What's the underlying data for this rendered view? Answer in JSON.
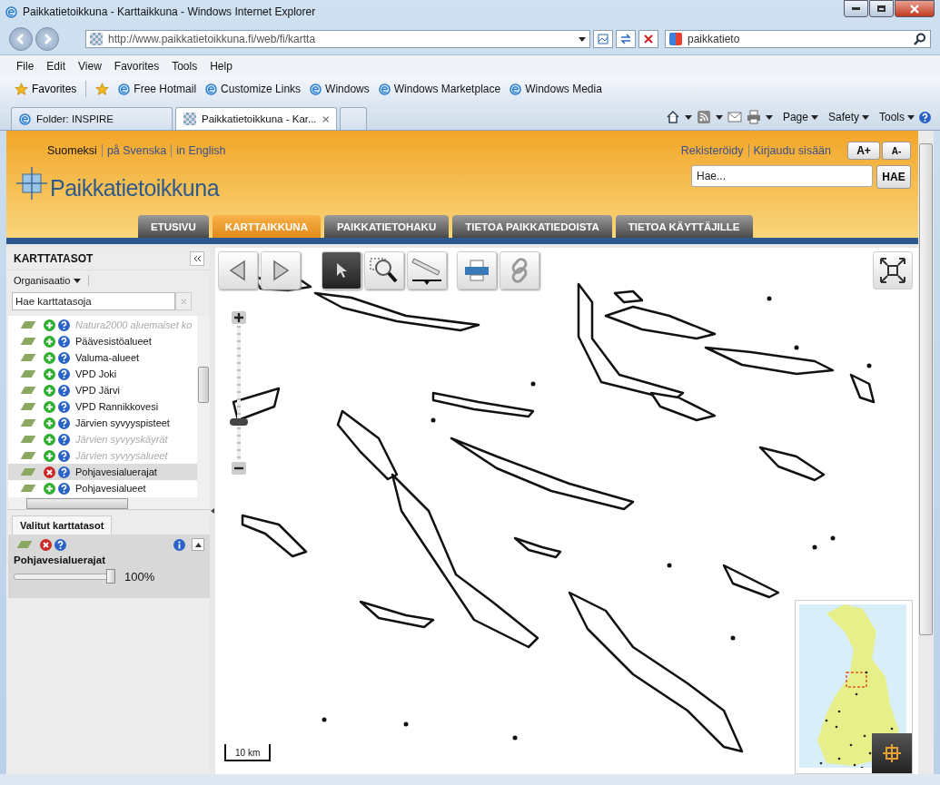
{
  "window": {
    "title": "Paikkatietoikkuna - Karttaikkuna - Windows Internet Explorer"
  },
  "address_bar": {
    "url": "http://www.paikkatietoikkuna.fi/web/fi/kartta"
  },
  "search_box": {
    "value": "paikkatieto"
  },
  "menu": [
    "File",
    "Edit",
    "View",
    "Favorites",
    "Tools",
    "Help"
  ],
  "favorites_bar": {
    "label": "Favorites",
    "links": [
      "Free Hotmail",
      "Customize Links",
      "Windows",
      "Windows Marketplace",
      "Windows Media"
    ]
  },
  "browser_tabs": [
    {
      "label": "Folder: INSPIRE",
      "selected": false
    },
    {
      "label": "Paikkatietoikkuna - Kar...",
      "selected": true
    }
  ],
  "command_bar": [
    "Page",
    "Safety",
    "Tools"
  ],
  "site": {
    "languages": [
      {
        "label": "Suomeksi",
        "selected": true
      },
      {
        "label": "på Svenska",
        "selected": false
      },
      {
        "label": "in English",
        "selected": false
      }
    ],
    "account_links": [
      "Rekisteröidy",
      "Kirjaudu sisään"
    ],
    "font_buttons": [
      "A+",
      "A-"
    ],
    "logo": "Paikkatietoikkuna",
    "search": {
      "placeholder": "Hae...",
      "button": "HAE"
    },
    "nav": [
      {
        "label": "ETUSIVU",
        "selected": false
      },
      {
        "label": "KARTTAIKKUNA",
        "selected": true
      },
      {
        "label": "PAIKKATIETOHAKU",
        "selected": false
      },
      {
        "label": "TIETOA PAIKKATIEDOISTA",
        "selected": false
      },
      {
        "label": "TIETOA KÄYTTÄJILLE",
        "selected": false
      }
    ]
  },
  "layer_panel": {
    "title": "KARTTATASOT",
    "filter": "Organisaatio",
    "search": {
      "placeholder": "Hae karttatasoja"
    },
    "layers": [
      {
        "name": "Natura2000 aluemaiset ko",
        "added": false,
        "disabled": true,
        "selected": false
      },
      {
        "name": "Päävesistöalueet",
        "added": false,
        "disabled": false,
        "selected": false
      },
      {
        "name": "Valuma-alueet",
        "added": false,
        "disabled": false,
        "selected": false
      },
      {
        "name": "VPD Joki",
        "added": false,
        "disabled": false,
        "selected": false
      },
      {
        "name": "VPD Järvi",
        "added": false,
        "disabled": false,
        "selected": false
      },
      {
        "name": "VPD Rannikkovesi",
        "added": false,
        "disabled": false,
        "selected": false
      },
      {
        "name": "Järvien syvyyspisteet",
        "added": false,
        "disabled": false,
        "selected": false
      },
      {
        "name": "Järvien syvyyskäyrät",
        "added": false,
        "disabled": true,
        "selected": false
      },
      {
        "name": "Järvien syvyysalueet",
        "added": false,
        "disabled": true,
        "selected": false
      },
      {
        "name": "Pohjavesialuerajat",
        "added": true,
        "disabled": false,
        "selected": true
      },
      {
        "name": "Pohjavesialueet",
        "added": false,
        "disabled": false,
        "selected": false
      }
    ]
  },
  "selected_layers": {
    "tab": "Valitut karttatasot",
    "layers": [
      {
        "name": "Pohjavesialuerajat",
        "opacity": {
          "level": 1,
          "reading": "100%"
        }
      }
    ]
  },
  "map": {
    "zoom": {
      "level": 0.27
    },
    "tools": [
      {
        "kind": "back",
        "selected": false
      },
      {
        "kind": "forward",
        "selected": false
      },
      {
        "kind": "select",
        "selected": true
      },
      {
        "kind": "zoom-box",
        "selected": false
      },
      {
        "kind": "measure",
        "selected": false
      },
      {
        "kind": "print",
        "selected": false
      },
      {
        "kind": "link",
        "selected": false
      }
    ],
    "scale": "10 km"
  }
}
